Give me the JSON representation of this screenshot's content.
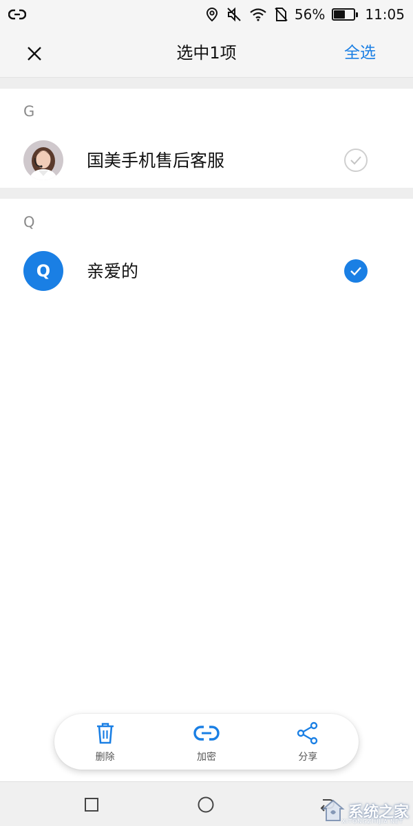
{
  "status_bar": {
    "battery_percent_label": "56%",
    "battery_level": 0.56,
    "time": "11:05",
    "icons": [
      "link-icon",
      "location-pin-icon",
      "muted-speaker-icon",
      "wifi-icon",
      "no-sim-icon",
      "battery-icon"
    ]
  },
  "app_bar": {
    "title": "选中1项",
    "select_all_label": "全选",
    "close_icon": "close-icon"
  },
  "contact_sections": [
    {
      "header": "G",
      "contacts": [
        {
          "name": "国美手机售后客服",
          "avatar_type": "photo",
          "selected": false
        }
      ]
    },
    {
      "header": "Q",
      "contacts": [
        {
          "name": "亲爱的",
          "avatar_type": "letter",
          "avatar_letter": "Q",
          "selected": true
        }
      ]
    }
  ],
  "action_bar": {
    "items": [
      {
        "label": "删除",
        "icon": "trash-icon"
      },
      {
        "label": "加密",
        "icon": "encrypt-link-icon"
      },
      {
        "label": "分享",
        "icon": "share-icon"
      }
    ]
  },
  "nav_bar": {
    "buttons": [
      "recent-apps-square-icon",
      "home-circle-icon",
      "back-icon"
    ]
  },
  "watermark": {
    "text": "系统之家",
    "subtext": "XITONGZHIJIA.NET"
  },
  "colors": {
    "accent": "#1a7fe4",
    "bar_background": "#f5f5f5",
    "section_gap": "#eeeeee"
  }
}
